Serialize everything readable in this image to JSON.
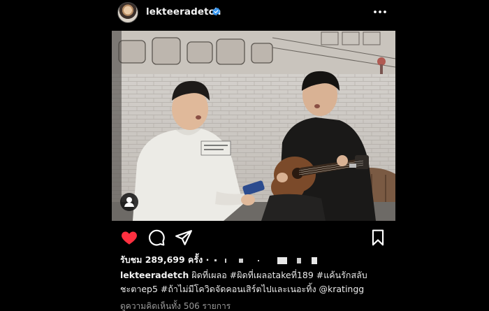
{
  "post": {
    "username": "lekteeradetch",
    "verified_icon": "verified-badge-icon",
    "more_icon": "more-options-icon"
  },
  "actions": {
    "like_icon": "heart-filled-icon",
    "comment_icon": "comment-icon",
    "share_icon": "send-icon",
    "save_icon": "bookmark-icon",
    "like_color": "#ff3040"
  },
  "likes": {
    "prefix": "รับชม",
    "count": "289,699",
    "suffix": "ครั้ง",
    "followers_text": "· "
  },
  "caption": {
    "username": "lekteeradetch",
    "text": "ผิดที่เผลอ #ผิดที่เผลอtakeที่189 #แค้นรักสลับชะตาep5 #ถ้าไม่มีโควิดจัดคอนเสิร์ตไปและเนอะทิ้ง @kratingg"
  },
  "comments": {
    "label": "ดูความคิดเห็นทั้ง 506 รายการ"
  },
  "colors": {
    "background": "#000000",
    "text": "#f2f2f2",
    "muted": "#9a9a9a",
    "verified": "#3897f0"
  }
}
